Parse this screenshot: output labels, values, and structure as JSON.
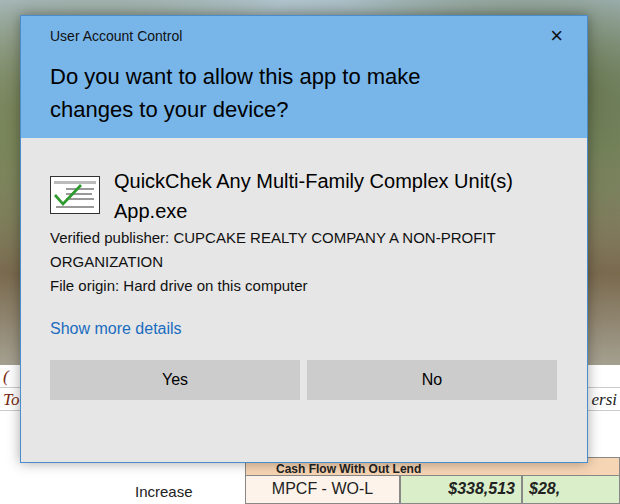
{
  "background": {
    "lines": [
      {
        "left": "(",
        "right": ""
      },
      {
        "left": "To",
        "right": "ersi"
      }
    ],
    "table": {
      "header": "Cash Flow With Out Lend",
      "rows": [
        {
          "label": "Increase",
          "cells": [
            "MPCF - WO-L",
            "$338,513",
            "$28,"
          ]
        }
      ]
    }
  },
  "dialog": {
    "title": "User Account Control",
    "close": "×",
    "question": "Do you want to allow this app to make changes to your device?",
    "app": {
      "name": "QuickChek Any Multi-Family Complex Unit(s) App.exe"
    },
    "publisher": "Verified publisher: CUPCAKE REALTY COMPANY A NON-PROFIT ORGANIZATION",
    "origin": "File origin: Hard drive on this computer",
    "details_link": "Show more details",
    "buttons": [
      "Yes",
      "No"
    ]
  }
}
